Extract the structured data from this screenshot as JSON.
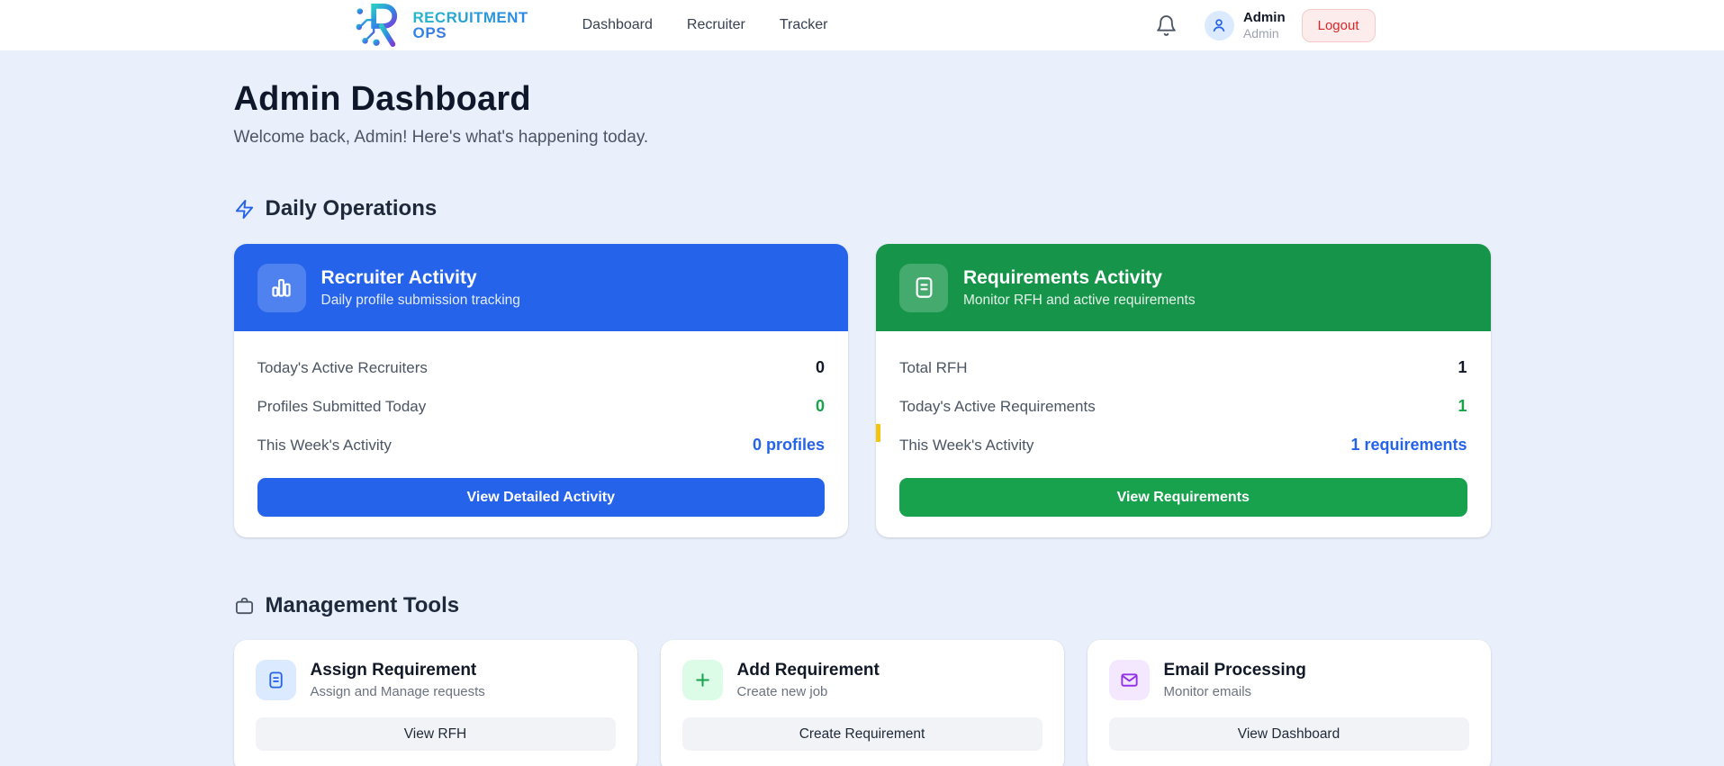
{
  "brand": {
    "line1": "RECRUITMENT",
    "line2": "OPS",
    "logo_icon": "circuit-r-logo"
  },
  "nav": {
    "items": [
      {
        "label": "Dashboard"
      },
      {
        "label": "Recruiter"
      },
      {
        "label": "Tracker"
      }
    ]
  },
  "header": {
    "bell_icon": "bell-icon",
    "avatar_icon": "user-icon",
    "user_name": "Admin",
    "user_role": "Admin",
    "logout_label": "Logout",
    "logout_color": "#dc2626"
  },
  "page": {
    "title": "Admin Dashboard",
    "subtitle": "Welcome back, Admin! Here's what's happening today."
  },
  "daily_operations": {
    "section_title": "Daily Operations",
    "section_icon": "lightning-icon",
    "cards": [
      {
        "title": "Recruiter Activity",
        "subtitle": "Daily profile submission tracking",
        "icon": "bar-chart-icon",
        "header_color": "#2563eb",
        "rows": [
          {
            "label": "Today's Active Recruiters",
            "value": "0",
            "value_color": "#111827"
          },
          {
            "label": "Profiles Submitted Today",
            "value": "0",
            "value_color": "#16a34a"
          },
          {
            "label": "This Week's Activity",
            "value": "0 profiles",
            "value_color": "#2563eb"
          }
        ],
        "button_label": "View Detailed Activity",
        "button_color": "#2563eb"
      },
      {
        "title": "Requirements Activity",
        "subtitle": "Monitor RFH and active requirements",
        "icon": "document-icon",
        "header_color": "#16954a",
        "rows": [
          {
            "label": "Total RFH",
            "value": "1",
            "value_color": "#111827"
          },
          {
            "label": "Today's Active Requirements",
            "value": "1",
            "value_color": "#16a34a"
          },
          {
            "label": "This Week's Activity",
            "value": "1 requirements",
            "value_color": "#2563eb"
          }
        ],
        "button_label": "View Requirements",
        "button_color": "#18a24d",
        "marker_color": "#f2c40f"
      }
    ]
  },
  "management_tools": {
    "section_title": "Management Tools",
    "section_icon": "briefcase-icon",
    "cards": [
      {
        "title": "Assign Requirement",
        "subtitle": "Assign and Manage requests",
        "button_label": "View RFH",
        "icon": "document-icon",
        "chip_bg": "#dbeafe",
        "icon_color": "#2563eb"
      },
      {
        "title": "Add Requirement",
        "subtitle": "Create new job",
        "button_label": "Create Requirement",
        "icon": "plus-icon",
        "chip_bg": "#dcfce7",
        "icon_color": "#16a34a"
      },
      {
        "title": "Email Processing",
        "subtitle": "Monitor emails",
        "button_label": "View Dashboard",
        "icon": "mail-icon",
        "chip_bg": "#f3e8ff",
        "icon_color": "#9333ea"
      }
    ]
  }
}
